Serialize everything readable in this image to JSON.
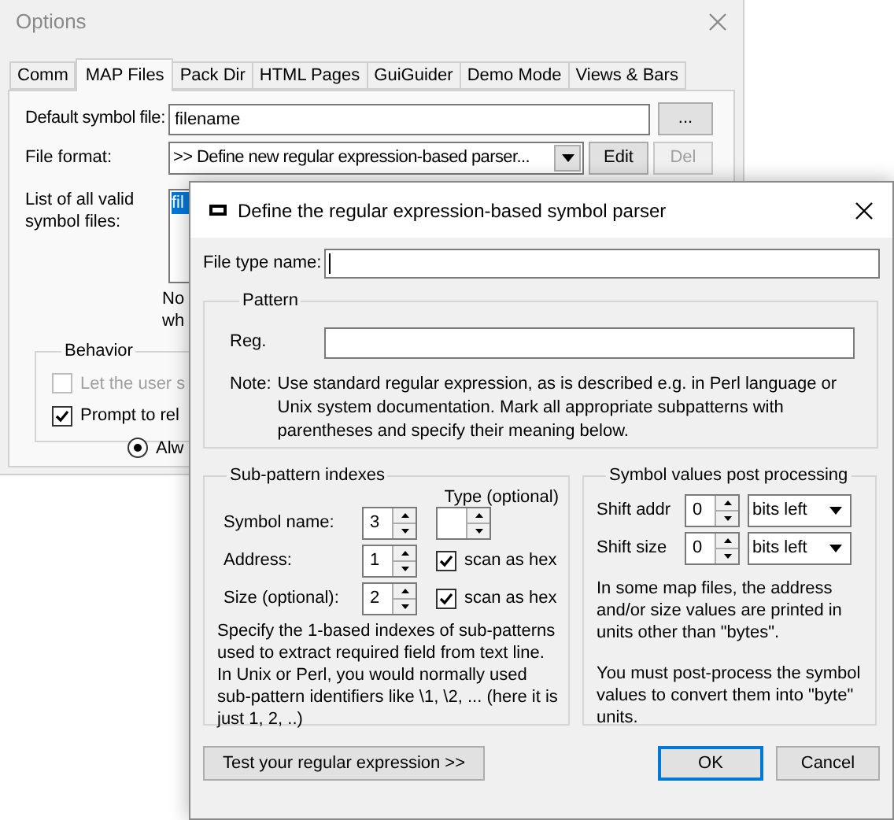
{
  "options_window": {
    "title": "Options",
    "tabs": [
      {
        "label": "Comm",
        "selected": false
      },
      {
        "label": "MAP Files",
        "selected": true
      },
      {
        "label": "Pack Dir",
        "selected": false
      },
      {
        "label": "HTML Pages",
        "selected": false
      },
      {
        "label": "GuiGuider",
        "selected": false
      },
      {
        "label": "Demo Mode",
        "selected": false
      },
      {
        "label": "Views & Bars",
        "selected": false
      }
    ],
    "default_symbol_file": {
      "label": "Default symbol file:",
      "value": "filename"
    },
    "browse_button": {
      "label": "...",
      "disabled": false
    },
    "file_format": {
      "label": "File format:",
      "value": ">> Define new regular expression-based parser..."
    },
    "edit_button": {
      "label": "Edit",
      "disabled": false
    },
    "del_button": {
      "label": "Del",
      "disabled": true
    },
    "symbol_files": {
      "label": "List of all valid symbol files:",
      "items": [
        {
          "text": "fil",
          "selected": true
        }
      ]
    },
    "note_fragments": [
      "No",
      "wh"
    ],
    "behavior": {
      "title": "Behavior",
      "options": [
        {
          "kind": "checkbox",
          "label": "Let the user s",
          "checked": false,
          "disabled": true
        },
        {
          "kind": "checkbox",
          "label": "Prompt to rel",
          "checked": true,
          "disabled": false
        },
        {
          "kind": "radio",
          "label": "Alw",
          "selected": true,
          "disabled": false
        }
      ]
    }
  },
  "dialog": {
    "title": "Define the regular expression-based symbol parser",
    "file_type_name": {
      "label": "File type name:",
      "focused": true
    },
    "pattern": {
      "title": "Pattern",
      "reg_label": "Reg.",
      "note_label": "Note:",
      "note": "Use standard regular expression, as is described e.g. in Perl language or Unix system documentation. Mark all appropriate subpatterns with parentheses and specify their meaning below."
    },
    "sub_pattern": {
      "title": "Sub-pattern indexes",
      "type_header": "Type (optional)",
      "rows": [
        {
          "kind": "type",
          "label": "Symbol name:",
          "value": "3"
        },
        {
          "kind": "hex",
          "label": "Address:",
          "value": "1",
          "option": "scan as hex",
          "checked": true
        },
        {
          "kind": "hex",
          "label": "Size (optional):",
          "value": "2",
          "option": "scan as hex",
          "checked": true
        }
      ],
      "description": "Specify the 1-based indexes of sub-patterns used to extract required field from text line. In Unix or Perl, you would normally used sub-pattern identifiers like \\1, \\2, ... (here it is just 1, 2, ..)"
    },
    "post_processing": {
      "title": "Symbol values post processing",
      "rows": [
        {
          "label": "Shift addr",
          "value": "0",
          "unit": "bits left"
        },
        {
          "label": "Shift size",
          "value": "0",
          "unit": "bits left"
        }
      ],
      "paragraphs": [
        "In some map files, the address and/or size values are printed in units other than \"bytes\".",
        "You must post-process the symbol values to convert them into \"byte\" units."
      ]
    },
    "buttons": [
      {
        "kind": "test",
        "label": "Test your regular expression >>",
        "default": false
      },
      {
        "kind": "ok",
        "label": "OK",
        "default": true
      },
      {
        "kind": "cancel",
        "label": "Cancel",
        "default": false
      }
    ]
  }
}
